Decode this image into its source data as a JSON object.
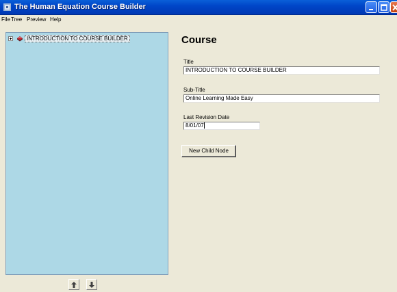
{
  "window": {
    "title": "The Human Equation Course Builder"
  },
  "menu": {
    "items": [
      "File",
      "Tree",
      "Preview",
      "Help"
    ]
  },
  "tree": {
    "root_label": "INTRODUCTION TO COURSE BUILDER",
    "root_icon": "book-icon",
    "panel_color": "#add8e6"
  },
  "form": {
    "heading": "Course",
    "title_label": "Title",
    "title_value": "INTRODUCTION TO COURSE BUILDER",
    "subtitle_label": "Sub-Title",
    "subtitle_value": "Online Learning Made Easy",
    "revision_label": "Last Revision Date",
    "revision_value": "8/01/07",
    "new_child_button": "New Child Node"
  },
  "icons": {
    "move_up": "arrow-up-icon",
    "move_down": "arrow-down-icon",
    "app": "app-icon"
  }
}
